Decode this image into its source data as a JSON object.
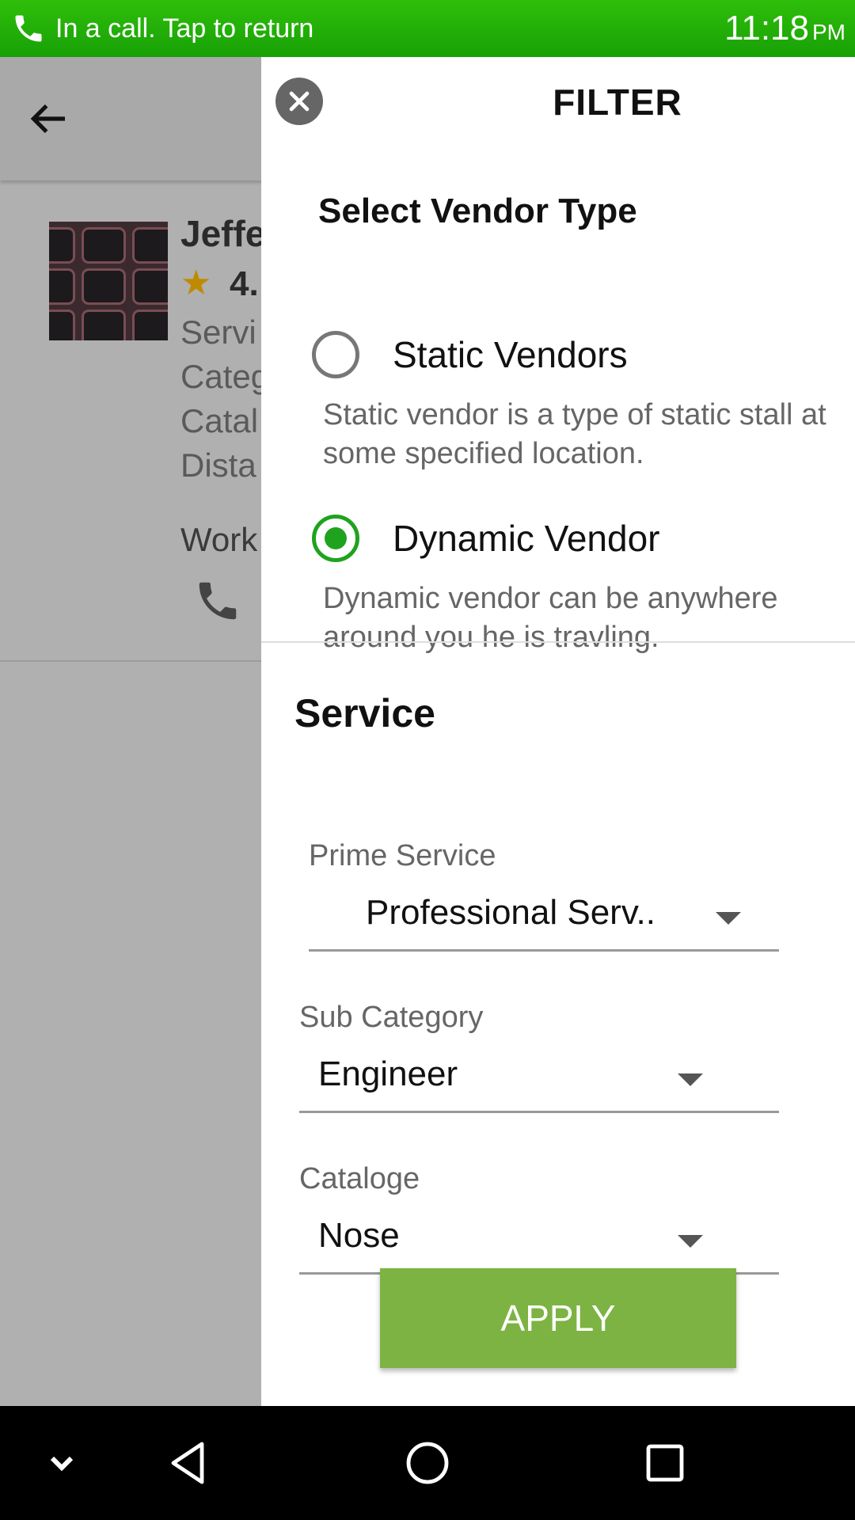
{
  "status_bar": {
    "call_text": "In a call. Tap to return",
    "time": "11:18",
    "ampm": "PM",
    "background_color": "#1fae08"
  },
  "background_app": {
    "vendor_name": "Jeffe",
    "rating": "4.",
    "lines": [
      "Servi",
      "Categ",
      "Catal",
      "Dista"
    ],
    "work_label": "Work"
  },
  "filter": {
    "title": "FILTER",
    "vendor_type": {
      "heading": "Select Vendor Type",
      "options": [
        {
          "label": "Static Vendors",
          "description": "Static vendor is a type of static stall at some specified location.",
          "selected": false
        },
        {
          "label": "Dynamic Vendor",
          "description": "Dynamic vendor can be anywhere around you he is travling.",
          "selected": true
        }
      ]
    },
    "service": {
      "heading": "Service",
      "prime_service": {
        "label": "Prime Service",
        "value": "Professional Serv.."
      },
      "sub_category": {
        "label": "Sub Category",
        "value": "Engineer"
      },
      "catalogue": {
        "label": "Cataloge",
        "value": "Nose"
      }
    },
    "apply_label": "APPLY",
    "accent_color": "#1fa31f",
    "apply_color": "#7cb342"
  },
  "icons": {
    "close": "close-icon",
    "back": "arrow-back-icon",
    "phone": "phone-icon",
    "nav": [
      "chevron-down-icon",
      "nav-back-icon",
      "nav-home-icon",
      "nav-recents-icon"
    ]
  }
}
